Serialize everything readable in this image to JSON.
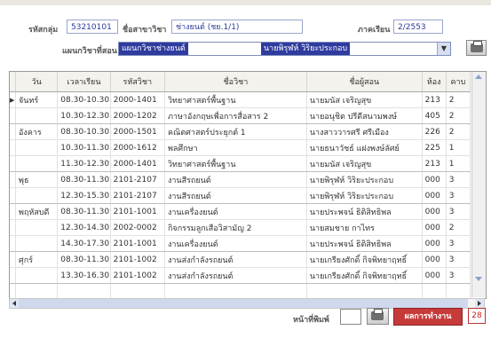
{
  "form": {
    "group_label": "รหัสกลุ่ม",
    "group_value": "53210101",
    "program_label": "ชื่อสาขาวิชา",
    "program_value": "ช่างยนต์ (ชย.1/1)",
    "term_label": "ภาคเรียน",
    "term_value": "2/2553",
    "teacher_label": "แผนกวิชาที่สอน",
    "teacher_select_dept": "แผนกวิชาช่างยนต์",
    "teacher_select_name": "นายพิรุฬห์  วิริยะประกอบ"
  },
  "table": {
    "headers": [
      "วัน",
      "เวลาเรียน",
      "รหัสวิชา",
      "ชื่อวิชา",
      "ชื่อผู้สอน",
      "ห้อง",
      "คาบ"
    ],
    "rows": [
      {
        "day": "จันทร์",
        "time": "08.30-10.30",
        "code": "2000-1401",
        "subject": "วิทยาศาสตร์พื้นฐาน",
        "teacher": "นายมนัส  เจริญสุข",
        "room": "213",
        "period": "2"
      },
      {
        "day": "",
        "time": "10.30-12.30",
        "code": "2000-1202",
        "subject": "ภาษาอังกฤษเพื่อการสื่อสาร 2",
        "teacher": "นายอนุชิต  ปรีดีสนามพงษ์",
        "room": "405",
        "period": "2"
      },
      {
        "day": "อังคาร",
        "time": "08.30-10.30",
        "code": "2000-1501",
        "subject": "คณิตศาสตร์ประยุกต์ 1",
        "teacher": "นางสาววารศรี  ศรีเมือง",
        "room": "226",
        "period": "2"
      },
      {
        "day": "",
        "time": "10.30-11.30",
        "code": "2000-1612",
        "subject": "พลศึกษา",
        "teacher": "นายธนาวัชธ์  แฝงพงษ์ลัศย์",
        "room": "225",
        "period": "1"
      },
      {
        "day": "",
        "time": "11.30-12.30",
        "code": "2000-1401",
        "subject": "วิทยาศาสตร์พื้นฐาน",
        "teacher": "นายมนัส  เจริญสุข",
        "room": "213",
        "period": "1"
      },
      {
        "day": "พุธ",
        "time": "08.30-11.30",
        "code": "2101-2107",
        "subject": "งานสีรถยนต์",
        "teacher": "นายพิรุฬห์  วิริยะประกอบ",
        "room": "000",
        "period": "3"
      },
      {
        "day": "",
        "time": "12.30-15.30",
        "code": "2101-2107",
        "subject": "งานสีรถยนต์",
        "teacher": "นายพิรุฬห์  วิริยะประกอบ",
        "room": "000",
        "period": "3"
      },
      {
        "day": "พฤหัสบดี",
        "time": "08.30-11.30",
        "code": "2101-1001",
        "subject": "งานเครื่องยนต์",
        "teacher": "นายประพจน์  ธิติสิทธิพล",
        "room": "000",
        "period": "3"
      },
      {
        "day": "",
        "time": "12.30-14.30",
        "code": "2002-0002",
        "subject": "กิจกรรมลูกเสือวิสามัญ 2",
        "teacher": "นายสมชาย  กาไทร",
        "room": "000",
        "period": "2"
      },
      {
        "day": "",
        "time": "14.30-17.30",
        "code": "2101-1001",
        "subject": "งานเครื่องยนต์",
        "teacher": "นายประพจน์  ธิติสิทธิพล",
        "room": "000",
        "period": "3"
      },
      {
        "day": "ศุกร์",
        "time": "08.30-11.30",
        "code": "2101-1002",
        "subject": "งานส่งกำลังรถยนต์",
        "teacher": "นายเกรียงศักดิ์  กิจพิทยาฤทธิ์",
        "room": "000",
        "period": "3"
      },
      {
        "day": "",
        "time": "13.30-16.30",
        "code": "2101-1002",
        "subject": "งานส่งกำลังรถยนต์",
        "teacher": "นายเกรียงศักดิ์  กิจพิทยาฤทธิ์",
        "room": "000",
        "period": "3"
      }
    ]
  },
  "footer": {
    "print_label": "หน้าที่พิมพ์",
    "run_label": "ผลการทำงาน",
    "count_value": "28"
  },
  "icons": {
    "print": "printer-icon",
    "row_pointer": "row-pointer-icon"
  },
  "colors": {
    "select_bg": "#2f3b9e",
    "run_button": "#c73a3a"
  }
}
